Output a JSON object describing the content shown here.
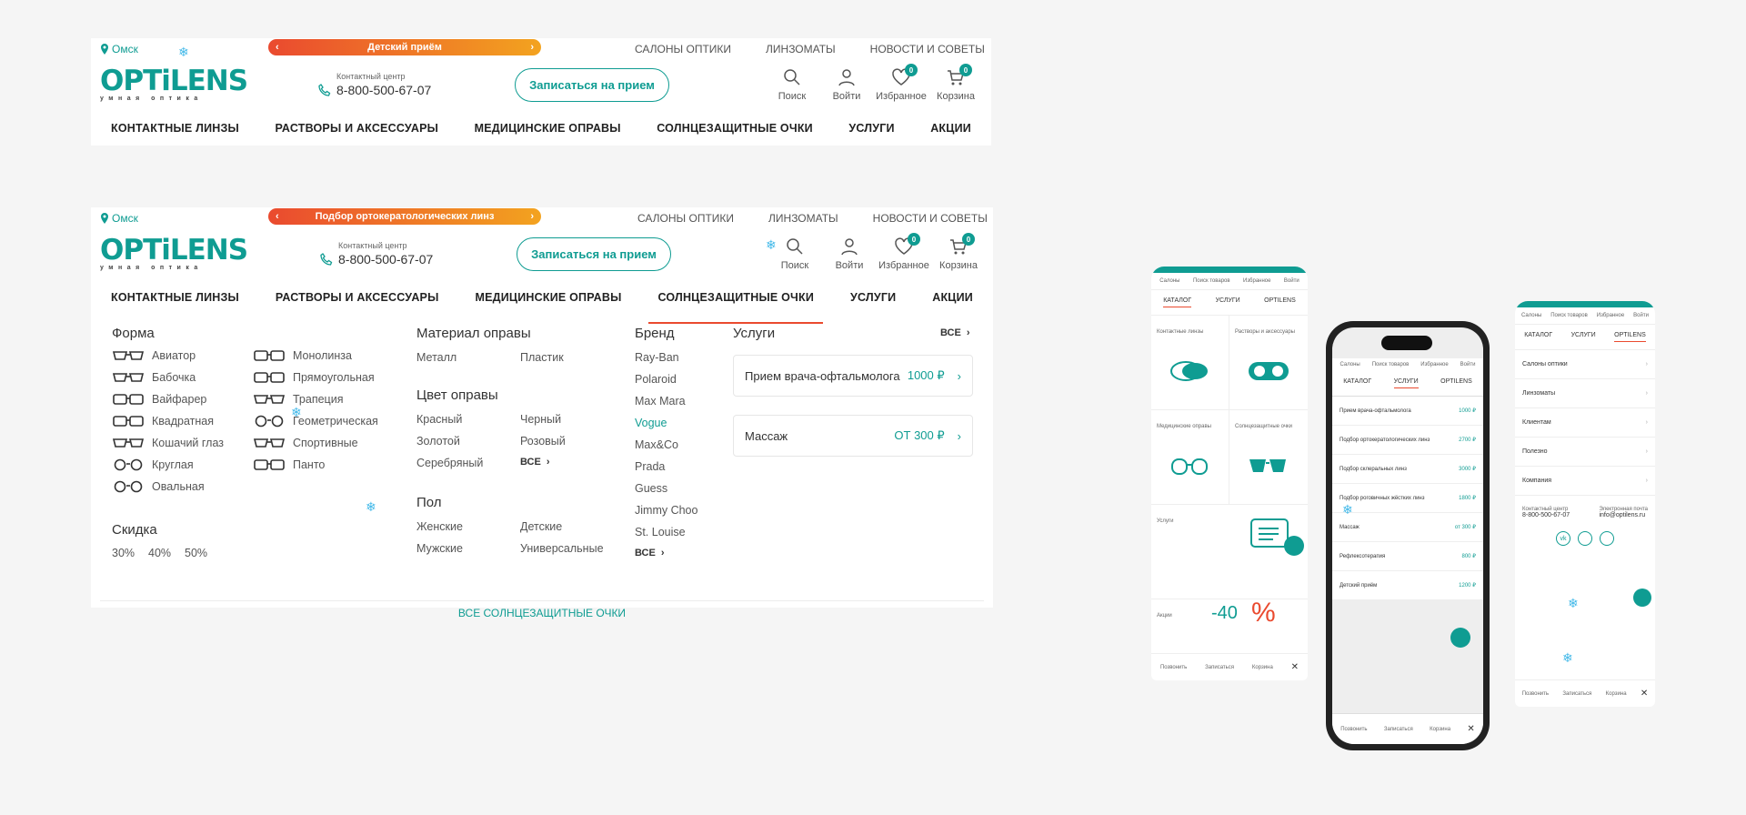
{
  "colors": {
    "accent": "#0f9c92",
    "promo_from": "#ea4a2f",
    "promo_to": "#f3a31f"
  },
  "header1": {
    "city": "Омск",
    "promo": "Детский приём"
  },
  "header2": {
    "city": "Омск",
    "promo": "Подбор ортокератологических линз"
  },
  "top_links": [
    "САЛОНЫ ОПТИКИ",
    "ЛИНЗОМАТЫ",
    "НОВОСТИ И СОВЕТЫ"
  ],
  "logo": {
    "word": "OPTiLENS",
    "sub": "умная оптика"
  },
  "contact": {
    "label": "Контактный центр",
    "phone": "8-800-500-67-07"
  },
  "cta": "Записаться на прием",
  "icons": [
    {
      "name": "search-icon",
      "label": "Поиск"
    },
    {
      "name": "user-icon",
      "label": "Войти"
    },
    {
      "name": "heart-icon",
      "label": "Избранное",
      "badge": "0"
    },
    {
      "name": "cart-icon",
      "label": "Корзина",
      "badge": "0"
    }
  ],
  "nav": [
    "КОНТАКТНЫЕ ЛИНЗЫ",
    "РАСТВОРЫ И АКСЕССУАРЫ",
    "МЕДИЦИНСКИЕ ОПРАВЫ",
    "СОЛНЦЕЗАЩИТНЫЕ ОЧКИ",
    "УСЛУГИ",
    "АКЦИИ"
  ],
  "mega": {
    "shape_title": "Форма",
    "shapes1": [
      "Авиатор",
      "Бабочка",
      "Вайфарер",
      "Квадратная",
      "Кошачий глаз",
      "Круглая",
      "Овальная"
    ],
    "shapes2": [
      "Монолинза",
      "Прямоугольная",
      "Трапеция",
      "Геометрическая",
      "Спортивные",
      "Панто"
    ],
    "discount_title": "Скидка",
    "discounts": [
      "30%",
      "40%",
      "50%"
    ],
    "material_title": "Материал оправы",
    "materials": [
      "Металл",
      "Пластик"
    ],
    "color_title": "Цвет оправы",
    "colors_a": [
      "Красный",
      "Золотой",
      "Серебряный"
    ],
    "colors_b": [
      "Черный",
      "Розовый"
    ],
    "all": "ВСЕ",
    "gender_title": "Пол",
    "gender_a": [
      "Женские",
      "Мужские"
    ],
    "gender_b": [
      "Детские",
      "Универсальные"
    ],
    "brand_title": "Бренд",
    "brands": [
      "Ray-Ban",
      "Polaroid",
      "Max Mara",
      "Vogue",
      "Max&Co",
      "Prada",
      "Guess",
      "Jimmy Choo",
      "St. Louise"
    ],
    "services_title": "Услуги",
    "services": [
      {
        "name": "Прием врача-офтальмолога",
        "price": "1000 ₽"
      },
      {
        "name": "Массаж",
        "price": "ОТ 300 ₽"
      }
    ],
    "footer": "ВСЕ СОЛНЦЕЗАЩИТНЫЕ ОЧКИ"
  },
  "mobile_left": {
    "top": [
      "Салоны",
      "Поиск товаров",
      "Избранное",
      "Войти"
    ],
    "tabs": [
      "КАТАЛОГ",
      "УСЛУГИ",
      "OPTILENS"
    ],
    "tiles": [
      "Контактные линзы",
      "Растворы и аксессуары",
      "Медицинские оправы",
      "Солнцезащитные очки",
      "Услуги",
      "Акции"
    ],
    "sale": "-40",
    "bottom": [
      "Позвонить",
      "Записаться",
      "Корзина"
    ]
  },
  "mobile_mid": {
    "top": [
      "Салоны",
      "Поиск товаров",
      "Избранное",
      "Войти"
    ],
    "tabs": [
      "КАТАЛОГ",
      "УСЛУГИ",
      "OPTILENS"
    ],
    "rows": [
      {
        "n": "Прием врача-офтальмолога",
        "p": "1000 ₽"
      },
      {
        "n": "Подбор ортокератологических линз",
        "p": "2700 ₽"
      },
      {
        "n": "Подбор склеральных линз",
        "p": "3000 ₽"
      },
      {
        "n": "Подбор роговичных жёстких линз",
        "p": "1800 ₽"
      },
      {
        "n": "Массаж",
        "p": "от 300 ₽"
      },
      {
        "n": "Рефлексотерапия",
        "p": "800 ₽"
      },
      {
        "n": "Детский приём",
        "p": "1200 ₽"
      }
    ],
    "bottom": [
      "Позвонить",
      "Записаться",
      "Корзина"
    ]
  },
  "mobile_right": {
    "top": [
      "Салоны",
      "Поиск товаров",
      "Избранное",
      "Войти"
    ],
    "tabs": [
      "КАТАЛОГ",
      "УСЛУГИ",
      "OPTILENS"
    ],
    "rows": [
      "Салоны оптики",
      "Линзоматы",
      "Клиентам",
      "Полезно",
      "Компания"
    ],
    "contact_label": "Контактный центр",
    "phone": "8-800-500-67-07",
    "mail_label": "Электронная почта",
    "mail": "info@optilens.ru",
    "bottom": [
      "Позвонить",
      "Записаться",
      "Корзина"
    ]
  }
}
